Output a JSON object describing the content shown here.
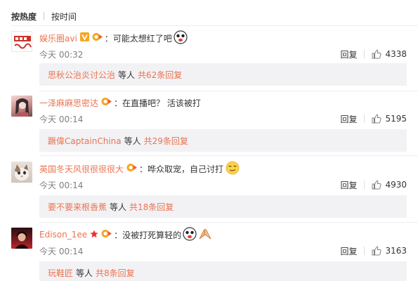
{
  "sort": {
    "hot_label": "按热度",
    "time_label": "按时间"
  },
  "comments": [
    {
      "username": "娱乐圈avi",
      "text": "：可能太想红了吧",
      "time": "今天 00:32",
      "reply_label": "回复",
      "likes": "4338",
      "avatar_text": "娱乐圈avi",
      "sub": {
        "user": "思秋公治炎讨公治",
        "mid": "等人",
        "total": "共62条回复"
      }
    },
    {
      "username": "一泽麻麻思密达",
      "text": "：在直播吧？ 活该被打",
      "time": "今天 00:14",
      "reply_label": "回复",
      "likes": "5195",
      "sub": {
        "user": "蹶偉CaptainChina",
        "mid": "等人",
        "total": "共29条回复"
      }
    },
    {
      "username": "英国冬天风很很很很大",
      "text": "：哗众取宠，自己讨打",
      "time": "今天 00:14",
      "reply_label": "回复",
      "likes": "4930",
      "sub": {
        "user": "要不要来根香蕉",
        "mid": "等人",
        "total": "共18条回复"
      }
    },
    {
      "username": "Edison_1ee",
      "text": "：没被打死算轻的",
      "time": "今天 00:14",
      "reply_label": "回复",
      "likes": "3163",
      "sub": {
        "user": "玩鞋匠",
        "mid": "等人",
        "total": "共8条回复"
      }
    }
  ]
}
